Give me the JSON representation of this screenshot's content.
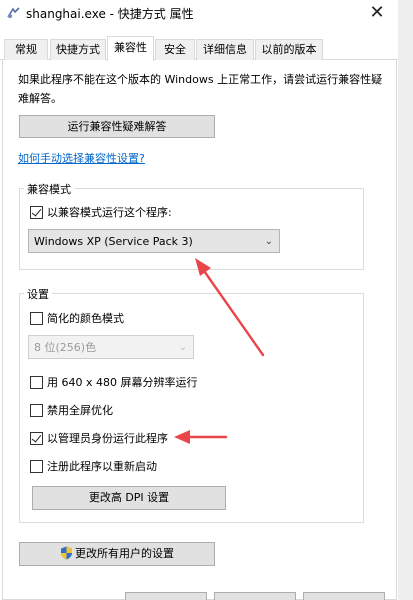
{
  "window": {
    "title": "shanghai.exe - 快捷方式 属性",
    "close_glyph": "✕"
  },
  "tabs": [
    {
      "label": "常规"
    },
    {
      "label": "快捷方式"
    },
    {
      "label": "兼容性",
      "active": true
    },
    {
      "label": "安全"
    },
    {
      "label": "详细信息"
    },
    {
      "label": "以前的版本"
    }
  ],
  "compatibility": {
    "description": "如果此程序不能在这个版本的 Windows 上正常工作，请尝试运行兼容性疑难解答。",
    "troubleshooter_button": "运行兼容性疑难解答",
    "manual_link": "如何手动选择兼容性设置?",
    "mode_group": {
      "label": "兼容模式",
      "run_in_mode_checkbox": "以兼容模式运行这个程序:",
      "run_in_mode_checked": true,
      "selected_os": "Windows XP (Service Pack 3)"
    },
    "settings_group": {
      "label": "设置",
      "reduced_color": {
        "label": "简化的颜色模式",
        "checked": false
      },
      "color_depth": "8 位(256)色",
      "res_640": {
        "label": "用 640 x 480 屏幕分辨率运行",
        "checked": false
      },
      "disable_fullscreen": {
        "label": "禁用全屏优化",
        "checked": false
      },
      "run_as_admin": {
        "label": "以管理员身份运行此程序",
        "checked": true
      },
      "register_restart": {
        "label": "注册此程序以重新启动",
        "checked": false
      },
      "dpi_button": "更改高 DPI 设置"
    },
    "all_users_button": "更改所有用户的设置"
  },
  "annotation_color": "#e8464a"
}
